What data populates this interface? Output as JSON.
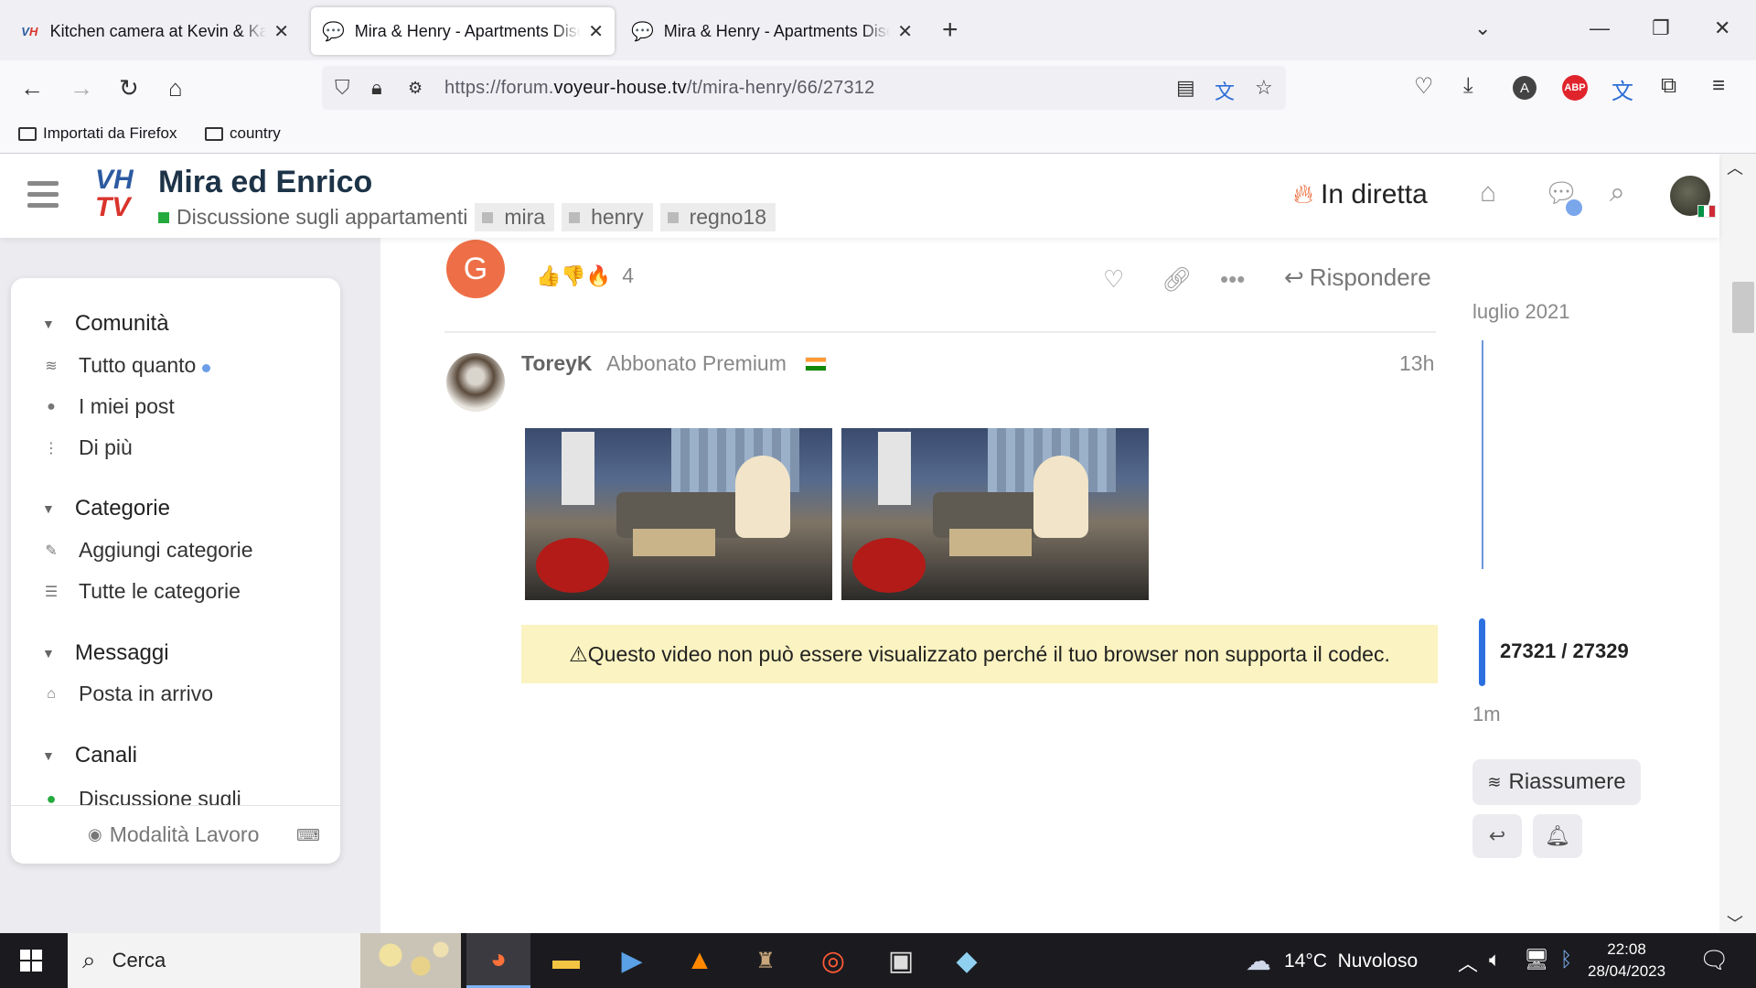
{
  "browser": {
    "tabs": [
      {
        "title": "Kitchen camera at Kevin & Karin",
        "favicon": "VH"
      },
      {
        "title": "Mira & Henry - Apartments Discussion",
        "favicon": "chat"
      },
      {
        "title": "Mira & Henry - Apartments Discussion",
        "favicon": "chat"
      }
    ],
    "active_tab": 1,
    "url_prefix": "https://forum.",
    "url_domain": "voyeur-house.tv",
    "url_path": "/t/mira-henry/66/27312",
    "bookmarks": [
      "Importati da Firefox",
      "country"
    ]
  },
  "header": {
    "logo_top": "VH",
    "logo_bottom": "TV",
    "topic_title": "Mira ed Enrico",
    "category": "Discussione sugli appartamenti",
    "category_color": "#25aa3e",
    "tags": [
      "mira",
      "henry",
      "regno18"
    ],
    "live_label": "In diretta"
  },
  "sidebar": {
    "sections": [
      {
        "title": "Comunità",
        "items": [
          {
            "label": "Tutto quanto",
            "icon": "layers-icon",
            "unread": true
          },
          {
            "label": "I miei post",
            "icon": "user-icon"
          },
          {
            "label": "Di più",
            "icon": "vertical-dots-icon"
          }
        ]
      },
      {
        "title": "Categorie",
        "items": [
          {
            "label": "Aggiungi categorie",
            "icon": "pencil-icon"
          },
          {
            "label": "Tutte le categorie",
            "icon": "list-icon"
          }
        ]
      },
      {
        "title": "Messaggi",
        "items": [
          {
            "label": "Posta in arrivo",
            "icon": "inbox-icon"
          }
        ]
      },
      {
        "title": "Canali",
        "items": [
          {
            "label": "Discussione sugli",
            "icon": "green-dot"
          }
        ]
      }
    ],
    "footer_label": "Modalità Lavoro"
  },
  "previous_post": {
    "avatar_letter": "G",
    "reactions": "👍👎🔥",
    "reaction_count": "4",
    "reply_label": "Rispondere"
  },
  "post": {
    "author": "ToreyK",
    "author_title": "Abbonato Premium",
    "time": "13h",
    "codec_notice": "Questo video non può essere visualizzato perché il tuo browser non supporta il codec."
  },
  "timeline": {
    "start_label": "luglio 2021",
    "position": "27321 / 27329",
    "end_label": "1m",
    "summarize_label": "Riassumere"
  },
  "taskbar": {
    "search_placeholder": "Cerca",
    "weather": "14°C  Nuvoloso",
    "time": "22:08",
    "date": "28/04/2023"
  }
}
